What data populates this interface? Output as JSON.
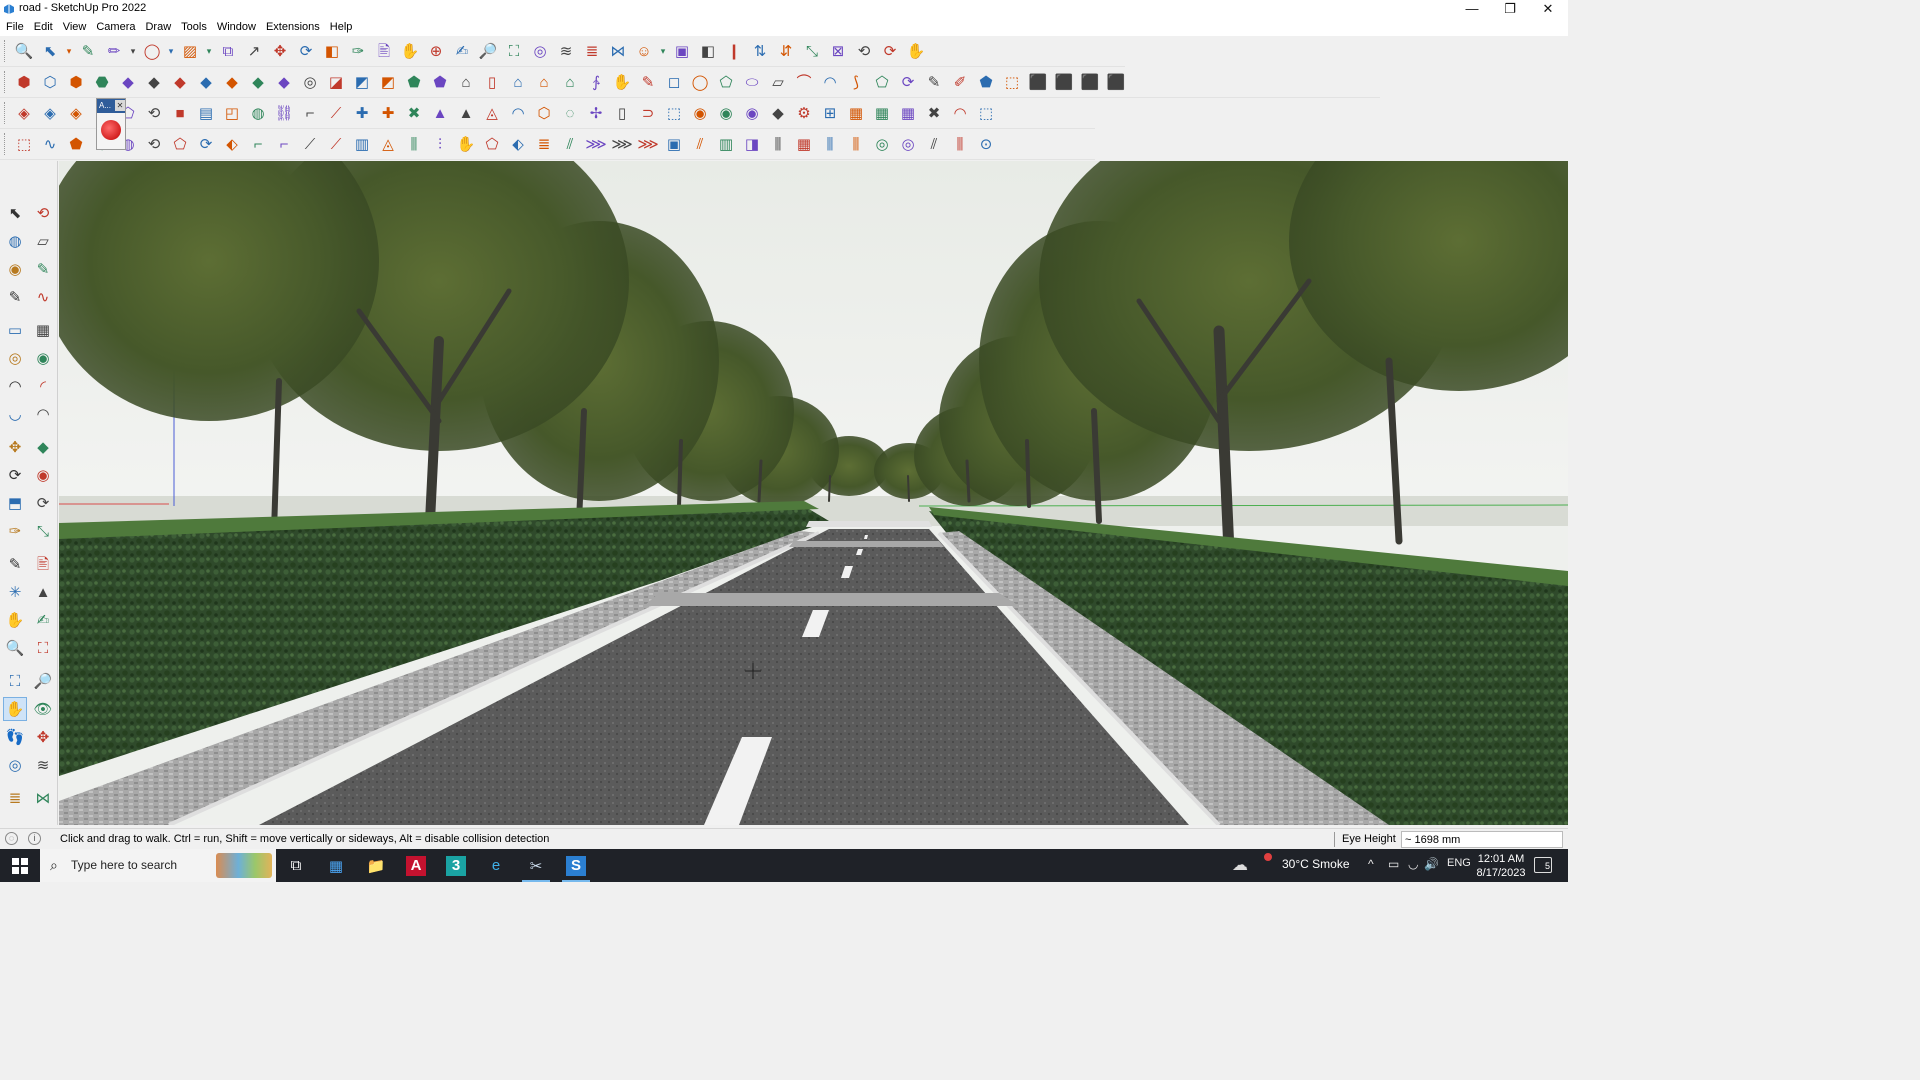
{
  "window": {
    "title": "road - SketchUp Pro 2022",
    "controls": {
      "minimize": "—",
      "restore": "❐",
      "close": "✕"
    }
  },
  "menu": {
    "items": [
      "File",
      "Edit",
      "View",
      "Camera",
      "Draw",
      "Tools",
      "Window",
      "Extensions",
      "Help"
    ]
  },
  "toolbars": {
    "row1": [
      "🔍",
      "⬉",
      "▾",
      "✎",
      "✏",
      "▾",
      "◯",
      "▾",
      "▨",
      "▾",
      "⧉",
      "↗",
      "✥",
      "⟳",
      "◧",
      "✑",
      "🖹",
      "✋",
      "⊕",
      "✍",
      "🔎",
      "⛶",
      "◎",
      "≋",
      "≣",
      "⋈",
      "☺",
      "▾",
      "▣",
      "◧",
      "❙",
      "⇅",
      "⇵",
      "⤡",
      "⊠",
      "⟲",
      "⟳",
      "✋"
    ],
    "row2": [
      "⬢",
      "⬡",
      "⬢",
      "⬣",
      "◆",
      "◆",
      "◆",
      "◆",
      "◆",
      "◆",
      "◆",
      "◎",
      "◪",
      "◩",
      "◩",
      "⬟",
      "⬟",
      "⌂",
      "▯",
      "⌂",
      "⌂",
      "⌂",
      "∱",
      "✋",
      "✎",
      "◻",
      "◯",
      "⬠",
      "⬭",
      "▱",
      "⌒",
      "◠",
      "⟆",
      "⬠",
      "⟳",
      "✎",
      "✐",
      "⬟",
      "⬚",
      "⬛",
      "⬛",
      "⬛",
      "⬛"
    ],
    "row3": [
      "◈",
      "◈",
      "◈",
      "⬢",
      "⬠",
      "⟲",
      "■",
      "▤",
      "◰",
      "◍",
      "⛓",
      "⌐",
      "⟋",
      "✚",
      "✚",
      "✖",
      "▲",
      "▲",
      "◬",
      "◠",
      "⬡",
      "◌",
      "✢",
      "▯",
      "⊃",
      "⬚",
      "◉",
      "◉",
      "◉",
      "◆",
      "⚙",
      "⊞",
      "▦",
      "▦",
      "▦",
      "✖",
      "◠",
      "⬚"
    ],
    "row4": [
      "⬚",
      "∿",
      "⬟",
      "⬡",
      "◍",
      "⟲",
      "⬠",
      "⟳",
      "⬖",
      "⌐",
      "⌐",
      "⟋",
      "⟋",
      "▥",
      "◬",
      "⫼",
      "⫶",
      "✋",
      "⬠",
      "⬖",
      "≣",
      "⫽",
      "⋙",
      "⋙",
      "⋙",
      "▣",
      "⫽",
      "▥",
      "◨",
      "⫼",
      "▦",
      "⫼",
      "⫼",
      "◎",
      "◎",
      "⫽",
      "⫼",
      "⊙"
    ],
    "floating_label": "A..."
  },
  "left_tools": [
    "⬉",
    "⟲",
    "◍",
    "▱",
    "◉",
    "✎",
    "✎",
    "∿",
    "▭",
    "▦",
    "◎",
    "◉",
    "◠",
    "◜",
    "◡",
    "◠",
    "✥",
    "◆",
    "⟳",
    "◉",
    "⬒",
    "⟳",
    "✑",
    "⤡",
    "✎",
    "🖹",
    "✳",
    "▲",
    "✋",
    "✍",
    "🔍",
    "⛶",
    "⛶",
    "🔎",
    "✋",
    "👁",
    "👣",
    "✥",
    "◎",
    "≋",
    "≣",
    "⋈"
  ],
  "status": {
    "message": "Click and drag to walk.  Ctrl = run, Shift = move vertically or sideways, Alt = disable collision detection",
    "vcb_label": "Eye Height",
    "vcb_value": "~ 1698 mm"
  },
  "taskbar": {
    "search_placeholder": "Type here to search",
    "apps": [
      "⧉",
      "▦",
      "📁",
      "A",
      "3",
      "e",
      "✂",
      "S"
    ],
    "weather": "30°C  Smoke",
    "tray": [
      "^",
      "▭",
      "◡",
      "🔊",
      "ENG"
    ],
    "time": "12:01 AM",
    "date": "8/17/2023",
    "notification_count": "5"
  },
  "colors": {
    "sky": "#eef0ed",
    "hedge": "#2e4a2a",
    "road": "#5a5a5a",
    "paving": "#9a9a9a",
    "tree_canopy": "#4d5f2a",
    "taskbar": "#1f2228",
    "active_tool": "#cfe3f7"
  }
}
